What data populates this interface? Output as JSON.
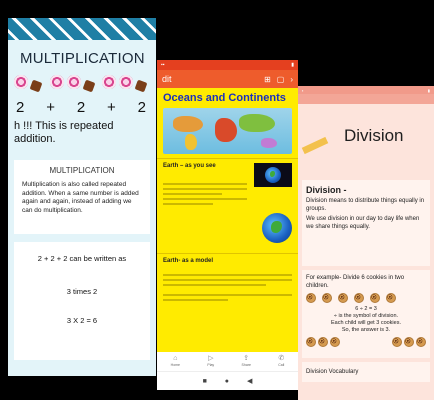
{
  "left_screen": {
    "title": "MULTIPLICATION",
    "sum": [
      "2",
      "+",
      "2",
      "+",
      "2"
    ],
    "note": "h !!! This is repeated addition.",
    "card_heading": "MULTIPLICATION",
    "card_text": "Multiplication is also called repeated addition. When a same number is added again and again, instead of adding we can do multiplication.",
    "lines": [
      "2 + 2 + 2 can be written as",
      "3 times 2",
      "3 X 2 = 6"
    ]
  },
  "middle_screen": {
    "app_label": "dit",
    "title": "Oceans and Continents",
    "section1_title": "Earth – as you see",
    "section2_title": "Earth- as a model",
    "nav_items": [
      "Home",
      "Play",
      "Share",
      "Call"
    ]
  },
  "right_screen": {
    "title": "Division",
    "definition_title": "Division -",
    "definition_text": "Division means to distribute things equally in groups.",
    "daily_text": "We use division in our day to day life when we share things equally.",
    "example_title": "For example- Divide 6 cookies in two children.",
    "equation": "6 ÷ 2 = 3",
    "symbol_note": "÷ is the symbol of division.",
    "result_note": "Each child will get 3 cookies.",
    "answer": "So, the answer is 3.",
    "vocab_title": "Division Vocabulary"
  },
  "colors": {
    "left_bg": "#e3f4f9",
    "middle_bg": "#ffeb00",
    "middle_appbar": "#ee5c2c",
    "right_bg": "#fde4dc"
  }
}
